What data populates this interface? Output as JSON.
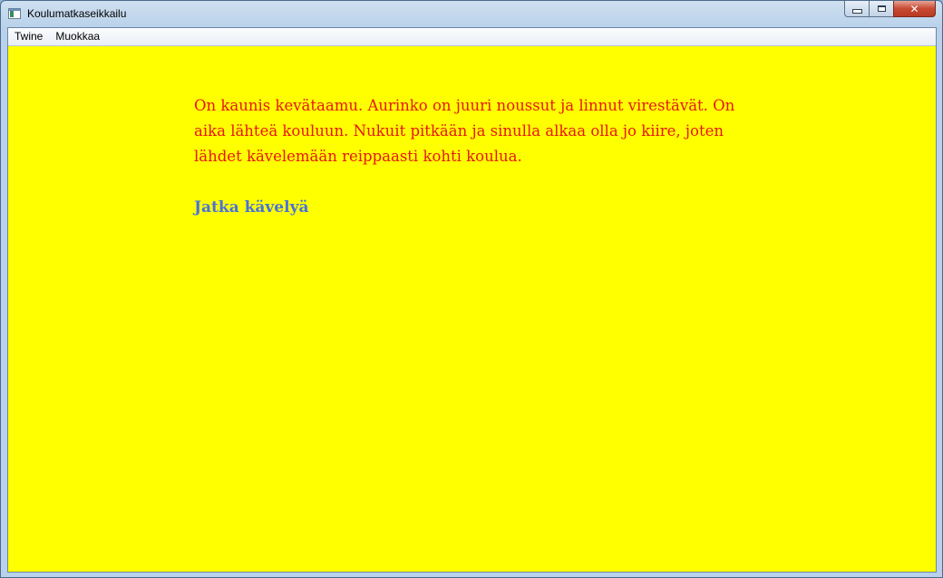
{
  "window": {
    "title": "Koulumatkaseikkailu",
    "close_glyph": "✕"
  },
  "menu": {
    "items": [
      "Twine",
      "Muokkaa"
    ]
  },
  "passage": {
    "text": "On kaunis kevätaamu. Aurinko on juuri noussut ja linnut virestävät. On aika lähteä kouluun. Nukuit pitkään ja sinulla alkaa olla jo kiire, joten lähdet kävelemään reippaasti kohti koulua.",
    "link_label": "Jatka kävelyä"
  },
  "colors": {
    "background": "#ffff00",
    "text": "#e8170f",
    "link": "#4a73d9"
  }
}
